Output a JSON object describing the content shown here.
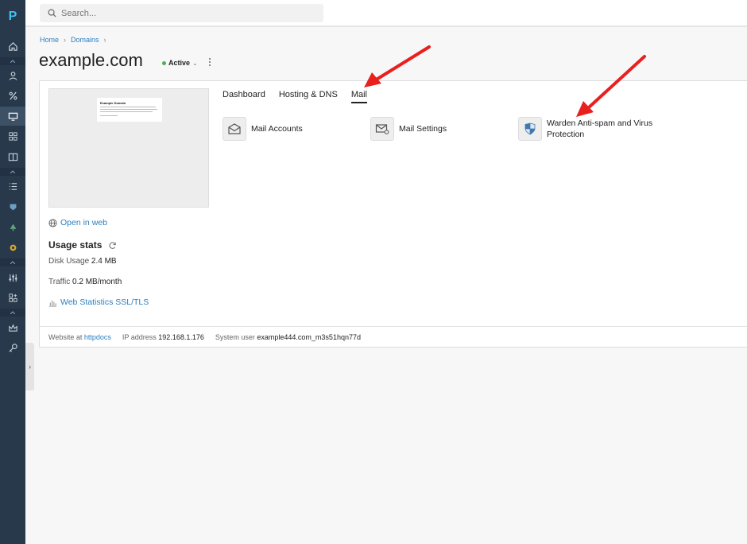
{
  "nav": {
    "logo": "P",
    "icons": [
      "home-icon",
      "user-icon",
      "percent-icon",
      "monitor-icon",
      "grid-icon",
      "book-icon",
      "list-icon",
      "shield-icon",
      "tree-icon",
      "puzzle-icon",
      "sliders-icon",
      "apps-icon",
      "crown-icon",
      "key-icon"
    ]
  },
  "search": {
    "placeholder": "Search..."
  },
  "breadcrumb": {
    "home": "Home",
    "domains": "Domains"
  },
  "domain": {
    "title": "example.com",
    "status": "Active"
  },
  "preview": {
    "heading": "Example Domain"
  },
  "links": {
    "open_in_web": "Open in web",
    "web_statistics": "Web Statistics SSL/TLS"
  },
  "usage": {
    "title": "Usage stats",
    "disk_label": "Disk Usage",
    "disk_value": "2.4 MB",
    "traffic_label": "Traffic",
    "traffic_value": "0.2 MB/month"
  },
  "footer": {
    "website_label": "Website at",
    "website_value": "httpdocs",
    "ip_label": "IP address",
    "ip_value": "192.168.1.176",
    "user_label": "System user",
    "user_value": "example444.com_m3s51hqn77d"
  },
  "tabs": [
    "Dashboard",
    "Hosting & DNS",
    "Mail"
  ],
  "active_tab": "Mail",
  "tiles": {
    "mail_accounts": "Mail Accounts",
    "mail_settings": "Mail Settings",
    "warden": "Warden Anti-spam and Virus Protection"
  },
  "colors": {
    "nav_bg": "#28394b",
    "link": "#2a7fc1",
    "status_green": "#4caf50",
    "arrow_red": "#e8201e"
  }
}
